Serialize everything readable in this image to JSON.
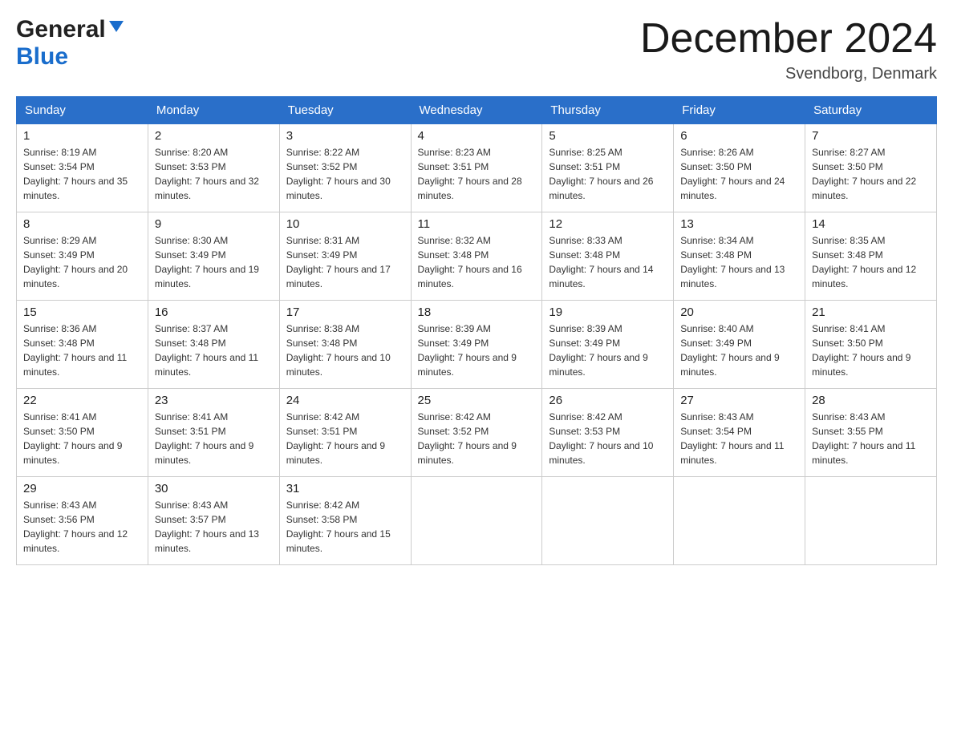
{
  "header": {
    "logo_general": "General",
    "logo_blue": "Blue",
    "month_title": "December 2024",
    "location": "Svendborg, Denmark"
  },
  "days_of_week": [
    "Sunday",
    "Monday",
    "Tuesday",
    "Wednesday",
    "Thursday",
    "Friday",
    "Saturday"
  ],
  "weeks": [
    [
      {
        "day": "1",
        "sunrise": "Sunrise: 8:19 AM",
        "sunset": "Sunset: 3:54 PM",
        "daylight": "Daylight: 7 hours and 35 minutes."
      },
      {
        "day": "2",
        "sunrise": "Sunrise: 8:20 AM",
        "sunset": "Sunset: 3:53 PM",
        "daylight": "Daylight: 7 hours and 32 minutes."
      },
      {
        "day": "3",
        "sunrise": "Sunrise: 8:22 AM",
        "sunset": "Sunset: 3:52 PM",
        "daylight": "Daylight: 7 hours and 30 minutes."
      },
      {
        "day": "4",
        "sunrise": "Sunrise: 8:23 AM",
        "sunset": "Sunset: 3:51 PM",
        "daylight": "Daylight: 7 hours and 28 minutes."
      },
      {
        "day": "5",
        "sunrise": "Sunrise: 8:25 AM",
        "sunset": "Sunset: 3:51 PM",
        "daylight": "Daylight: 7 hours and 26 minutes."
      },
      {
        "day": "6",
        "sunrise": "Sunrise: 8:26 AM",
        "sunset": "Sunset: 3:50 PM",
        "daylight": "Daylight: 7 hours and 24 minutes."
      },
      {
        "day": "7",
        "sunrise": "Sunrise: 8:27 AM",
        "sunset": "Sunset: 3:50 PM",
        "daylight": "Daylight: 7 hours and 22 minutes."
      }
    ],
    [
      {
        "day": "8",
        "sunrise": "Sunrise: 8:29 AM",
        "sunset": "Sunset: 3:49 PM",
        "daylight": "Daylight: 7 hours and 20 minutes."
      },
      {
        "day": "9",
        "sunrise": "Sunrise: 8:30 AM",
        "sunset": "Sunset: 3:49 PM",
        "daylight": "Daylight: 7 hours and 19 minutes."
      },
      {
        "day": "10",
        "sunrise": "Sunrise: 8:31 AM",
        "sunset": "Sunset: 3:49 PM",
        "daylight": "Daylight: 7 hours and 17 minutes."
      },
      {
        "day": "11",
        "sunrise": "Sunrise: 8:32 AM",
        "sunset": "Sunset: 3:48 PM",
        "daylight": "Daylight: 7 hours and 16 minutes."
      },
      {
        "day": "12",
        "sunrise": "Sunrise: 8:33 AM",
        "sunset": "Sunset: 3:48 PM",
        "daylight": "Daylight: 7 hours and 14 minutes."
      },
      {
        "day": "13",
        "sunrise": "Sunrise: 8:34 AM",
        "sunset": "Sunset: 3:48 PM",
        "daylight": "Daylight: 7 hours and 13 minutes."
      },
      {
        "day": "14",
        "sunrise": "Sunrise: 8:35 AM",
        "sunset": "Sunset: 3:48 PM",
        "daylight": "Daylight: 7 hours and 12 minutes."
      }
    ],
    [
      {
        "day": "15",
        "sunrise": "Sunrise: 8:36 AM",
        "sunset": "Sunset: 3:48 PM",
        "daylight": "Daylight: 7 hours and 11 minutes."
      },
      {
        "day": "16",
        "sunrise": "Sunrise: 8:37 AM",
        "sunset": "Sunset: 3:48 PM",
        "daylight": "Daylight: 7 hours and 11 minutes."
      },
      {
        "day": "17",
        "sunrise": "Sunrise: 8:38 AM",
        "sunset": "Sunset: 3:48 PM",
        "daylight": "Daylight: 7 hours and 10 minutes."
      },
      {
        "day": "18",
        "sunrise": "Sunrise: 8:39 AM",
        "sunset": "Sunset: 3:49 PM",
        "daylight": "Daylight: 7 hours and 9 minutes."
      },
      {
        "day": "19",
        "sunrise": "Sunrise: 8:39 AM",
        "sunset": "Sunset: 3:49 PM",
        "daylight": "Daylight: 7 hours and 9 minutes."
      },
      {
        "day": "20",
        "sunrise": "Sunrise: 8:40 AM",
        "sunset": "Sunset: 3:49 PM",
        "daylight": "Daylight: 7 hours and 9 minutes."
      },
      {
        "day": "21",
        "sunrise": "Sunrise: 8:41 AM",
        "sunset": "Sunset: 3:50 PM",
        "daylight": "Daylight: 7 hours and 9 minutes."
      }
    ],
    [
      {
        "day": "22",
        "sunrise": "Sunrise: 8:41 AM",
        "sunset": "Sunset: 3:50 PM",
        "daylight": "Daylight: 7 hours and 9 minutes."
      },
      {
        "day": "23",
        "sunrise": "Sunrise: 8:41 AM",
        "sunset": "Sunset: 3:51 PM",
        "daylight": "Daylight: 7 hours and 9 minutes."
      },
      {
        "day": "24",
        "sunrise": "Sunrise: 8:42 AM",
        "sunset": "Sunset: 3:51 PM",
        "daylight": "Daylight: 7 hours and 9 minutes."
      },
      {
        "day": "25",
        "sunrise": "Sunrise: 8:42 AM",
        "sunset": "Sunset: 3:52 PM",
        "daylight": "Daylight: 7 hours and 9 minutes."
      },
      {
        "day": "26",
        "sunrise": "Sunrise: 8:42 AM",
        "sunset": "Sunset: 3:53 PM",
        "daylight": "Daylight: 7 hours and 10 minutes."
      },
      {
        "day": "27",
        "sunrise": "Sunrise: 8:43 AM",
        "sunset": "Sunset: 3:54 PM",
        "daylight": "Daylight: 7 hours and 11 minutes."
      },
      {
        "day": "28",
        "sunrise": "Sunrise: 8:43 AM",
        "sunset": "Sunset: 3:55 PM",
        "daylight": "Daylight: 7 hours and 11 minutes."
      }
    ],
    [
      {
        "day": "29",
        "sunrise": "Sunrise: 8:43 AM",
        "sunset": "Sunset: 3:56 PM",
        "daylight": "Daylight: 7 hours and 12 minutes."
      },
      {
        "day": "30",
        "sunrise": "Sunrise: 8:43 AM",
        "sunset": "Sunset: 3:57 PM",
        "daylight": "Daylight: 7 hours and 13 minutes."
      },
      {
        "day": "31",
        "sunrise": "Sunrise: 8:42 AM",
        "sunset": "Sunset: 3:58 PM",
        "daylight": "Daylight: 7 hours and 15 minutes."
      },
      null,
      null,
      null,
      null
    ]
  ]
}
